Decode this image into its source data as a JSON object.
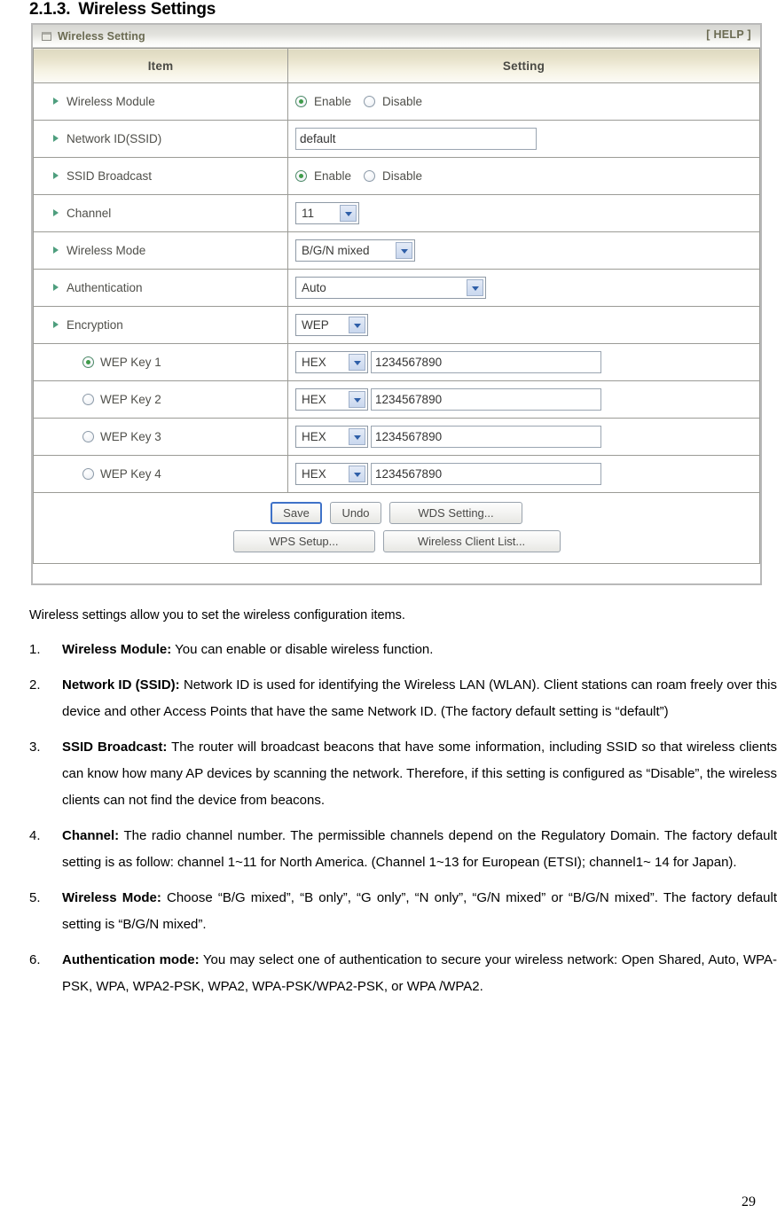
{
  "heading": {
    "number": "2.1.3.",
    "title": "Wireless Settings"
  },
  "panel": {
    "title": "Wireless Setting",
    "help_label": "[ HELP ]",
    "columns": {
      "item": "Item",
      "setting": "Setting"
    },
    "rows": [
      {
        "label": "Wireless Module",
        "control": "radio-enable-disable",
        "options": [
          "Enable",
          "Disable"
        ],
        "selected": "Enable"
      },
      {
        "label": "Network ID(SSID)",
        "control": "text",
        "value": "default"
      },
      {
        "label": "SSID Broadcast",
        "control": "radio-enable-disable",
        "options": [
          "Enable",
          "Disable"
        ],
        "selected": "Enable"
      },
      {
        "label": "Channel",
        "control": "select",
        "value": "11"
      },
      {
        "label": "Wireless Mode",
        "control": "select",
        "value": "B/G/N mixed"
      },
      {
        "label": "Authentication",
        "control": "select",
        "value": "Auto"
      },
      {
        "label": "Encryption",
        "control": "select",
        "value": "WEP"
      }
    ],
    "wep_keys": [
      {
        "label": "WEP Key 1",
        "selected": true,
        "format": "HEX",
        "value": "1234567890"
      },
      {
        "label": "WEP Key 2",
        "selected": false,
        "format": "HEX",
        "value": "1234567890"
      },
      {
        "label": "WEP Key 3",
        "selected": false,
        "format": "HEX",
        "value": "1234567890"
      },
      {
        "label": "WEP Key 4",
        "selected": false,
        "format": "HEX",
        "value": "1234567890"
      }
    ],
    "buttons": {
      "save": "Save",
      "undo": "Undo",
      "wds_setting": "WDS Setting...",
      "wps_setup": "WPS Setup...",
      "wireless_client_list": "Wireless Client List..."
    }
  },
  "body": {
    "intro": "Wireless settings allow you to set the wireless configuration items.",
    "items": [
      {
        "marker": "1.",
        "term": "Wireless Module:",
        "text": " You can enable or disable wireless function."
      },
      {
        "marker": "2.",
        "term": "Network ID (SSID):",
        "text": " Network ID is used for identifying the Wireless LAN (WLAN). Client stations can roam freely over this device and other Access Points that have the same Network ID. (The factory default setting is “default”)"
      },
      {
        "marker": "3.",
        "term": "SSID Broadcast:",
        "text": " The router will broadcast beacons that have some information, including SSID so that wireless clients can know how many AP devices by scanning the network. Therefore, if this setting is configured as “Disable”, the wireless clients can not find the device from beacons."
      },
      {
        "marker": "4.",
        "term": "Channel:",
        "text": " The radio channel number. The permissible channels depend on the Regulatory Domain. The factory default setting is as follow: channel 1~11 for North America. (Channel 1~13 for European (ETSI); channel1~ 14 for Japan)."
      },
      {
        "marker": "5.",
        "term": "Wireless Mode:",
        "text": " Choose “B/G mixed”, “B only”, “G only”, “N only”, “G/N mixed” or “B/G/N mixed”. The factory default setting is “B/G/N mixed”."
      },
      {
        "marker": "6.",
        "term": "Authentication mode:",
        "text": " You may select one of authentication to secure your wireless network:  Open  Shared,  Auto,  WPA-PSK,  WPA,  WPA2-PSK,  WPA2, WPA-PSK/WPA2-PSK, or WPA /WPA2."
      }
    ]
  },
  "footer": {
    "page_number": "29"
  },
  "colors": {
    "bullet_green": "#4e9e7e",
    "radio_green": "#3f9b4a",
    "panel_title_text": "#6b6b52",
    "header_cream": "#e8e3cc",
    "focus_blue": "#3f72c8"
  }
}
